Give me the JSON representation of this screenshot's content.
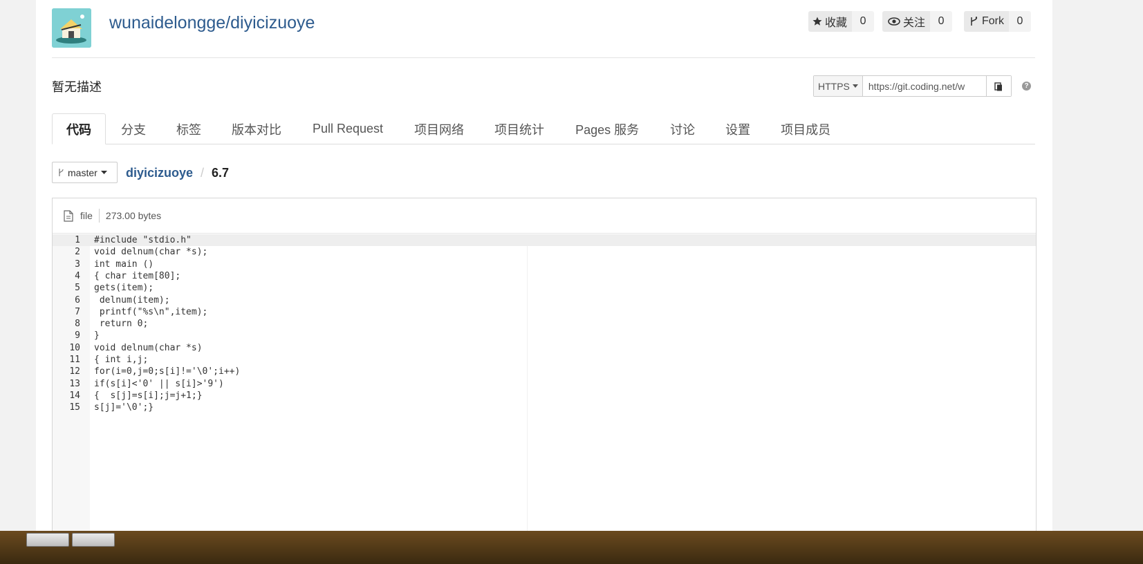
{
  "header": {
    "repo_title": "wunaidelongge/diyicizuoye",
    "star": {
      "label": "收藏",
      "count": "0"
    },
    "watch": {
      "label": "关注",
      "count": "0"
    },
    "fork": {
      "label": "Fork",
      "count": "0"
    }
  },
  "description": "暂无描述",
  "clone": {
    "protocol": "HTTPS",
    "url": "https://git.coding.net/w"
  },
  "help_label": "?",
  "tabs": [
    {
      "label": "代码",
      "active": true
    },
    {
      "label": "分支"
    },
    {
      "label": "标签"
    },
    {
      "label": "版本对比"
    },
    {
      "label": "Pull Request"
    },
    {
      "label": "项目网络"
    },
    {
      "label": "项目统计"
    },
    {
      "label": "Pages 服务"
    },
    {
      "label": "讨论"
    },
    {
      "label": "设置"
    },
    {
      "label": "项目成员"
    }
  ],
  "branch": {
    "name": "master"
  },
  "breadcrumb": {
    "repo": "diyicizuoye",
    "separator": "/",
    "file": "6.7"
  },
  "file_info": {
    "type": "file",
    "size": "273.00 bytes"
  },
  "code_lines": [
    "#include \"stdio.h\"",
    "void delnum(char *s);",
    "int main ()",
    "{ char item[80];",
    "gets(item);",
    " delnum(item);",
    " printf(\"%s\\n\",item);",
    " return 0;",
    "}",
    "void delnum(char *s)",
    "{ int i,j;",
    "for(i=0,j=0;s[i]!='\\0';i++)",
    "if(s[i]<'0' || s[i]>'9')",
    "{  s[j]=s[i];j=j+1;}",
    "s[j]='\\0';}"
  ],
  "colors": {
    "link": "#2d5b8e",
    "gutter": "#f7f7f7",
    "highlight_line": "#eeeeee",
    "logo_bg": "#7fd1d4"
  },
  "icons": {
    "star": "star-icon",
    "watch": "eye-icon",
    "fork": "fork-icon",
    "copy": "clipboard-icon",
    "file": "file-icon",
    "branch": "branch-icon"
  }
}
